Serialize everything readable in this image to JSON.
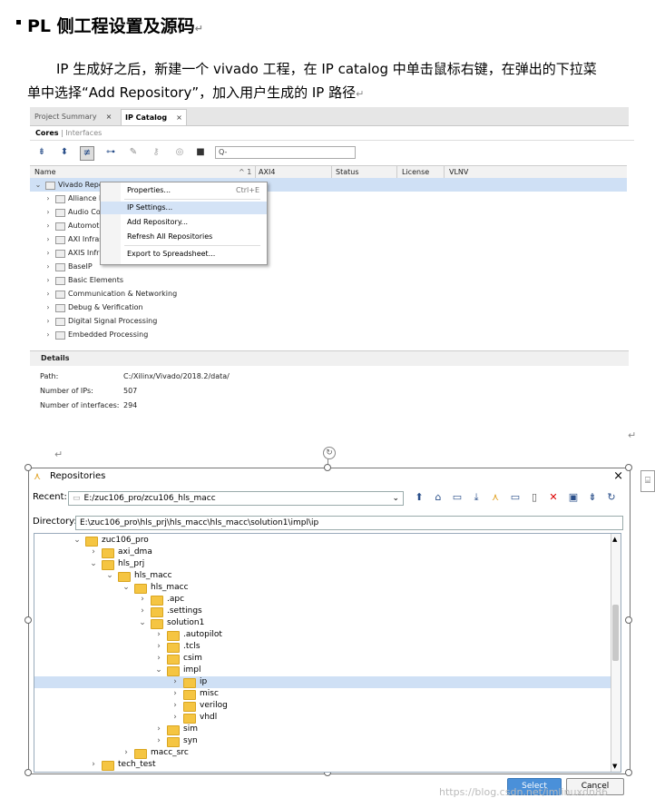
{
  "heading": {
    "title": "PL 侧工程设置及源码",
    "mark": "↵"
  },
  "paragraph": {
    "line1": "IP 生成好之后，新建一个 vivado 工程，在 IP catalog 中单击鼠标右键，在弹出的下拉菜",
    "line2": "单中选择“Add Repository”，加入用户生成的 IP 路径",
    "mark": "↵"
  },
  "vivado": {
    "tabs": [
      {
        "label": "Project Summary",
        "close": "×"
      },
      {
        "label": "IP Catalog",
        "close": "×"
      }
    ],
    "subtabs": {
      "active": "Cores",
      "sep": "|",
      "inactive": "Interfaces"
    },
    "search_placeholder": "Q-",
    "columns": {
      "name": "Name",
      "sort": "^ 1",
      "axi4": "AXI4",
      "status": "Status",
      "license": "License",
      "vlnv": "VLNV"
    },
    "rows": [
      "Vivado Repo",
      "Alliance P",
      "Audio Co",
      "Automotiv",
      "AXI Infras",
      "AXIS Infra",
      "BaseIP",
      "Basic Elements",
      "Communication & Networking",
      "Debug & Verification",
      "Digital Signal Processing",
      "Embedded Processing"
    ],
    "menu": {
      "properties": "Properties...",
      "properties_key": "Ctrl+E",
      "ip_settings": "IP Settings...",
      "add_repo": "Add Repository...",
      "refresh": "Refresh All Repositories",
      "export": "Export to Spreadsheet..."
    },
    "details": {
      "title": "Details",
      "path_label": "Path:",
      "path_value": "C:/Xilinx/Vivado/2018.2/data/",
      "nips_label": "Number of IPs:",
      "nips_value": "507",
      "nifc_label": "Number of interfaces:",
      "nifc_value": "294"
    },
    "mark1": "↵",
    "mark2": "↵"
  },
  "repos": {
    "title": "Repositories",
    "close": "×",
    "recent_label": "Recent:",
    "recent_value": "E:/zuc106_pro/zcu106_hls_macc",
    "directory_label": "Directory:",
    "directory_value": "E:\\zuc106_pro\\hls_prj\\hls_macc\\hls_macc\\solution1\\impl\\ip",
    "tree": [
      {
        "label": "zuc106_pro",
        "depth": 0,
        "expanded": true
      },
      {
        "label": "axi_dma",
        "depth": 1,
        "expanded": false
      },
      {
        "label": "hls_prj",
        "depth": 1,
        "expanded": true
      },
      {
        "label": "hls_macc",
        "depth": 2,
        "expanded": true
      },
      {
        "label": "hls_macc",
        "depth": 3,
        "expanded": true
      },
      {
        "label": ".apc",
        "depth": 4,
        "expanded": false
      },
      {
        "label": ".settings",
        "depth": 4,
        "expanded": false
      },
      {
        "label": "solution1",
        "depth": 4,
        "expanded": true
      },
      {
        "label": ".autopilot",
        "depth": 5,
        "expanded": false
      },
      {
        "label": ".tcls",
        "depth": 5,
        "expanded": false
      },
      {
        "label": "csim",
        "depth": 5,
        "expanded": false
      },
      {
        "label": "impl",
        "depth": 5,
        "expanded": true
      },
      {
        "label": "ip",
        "depth": 6,
        "expanded": false,
        "selected": true
      },
      {
        "label": "misc",
        "depth": 6,
        "expanded": false
      },
      {
        "label": "verilog",
        "depth": 6,
        "expanded": false
      },
      {
        "label": "vhdl",
        "depth": 6,
        "expanded": false
      },
      {
        "label": "sim",
        "depth": 5,
        "expanded": false
      },
      {
        "label": "syn",
        "depth": 5,
        "expanded": false
      },
      {
        "label": "macc_src",
        "depth": 3,
        "expanded": false
      },
      {
        "label": "tech_test",
        "depth": 1,
        "expanded": false
      }
    ],
    "select_label": "Select",
    "cancel_label": "Cancel",
    "watermark": "https://blog.csdn.net/imlinuxdn86"
  }
}
